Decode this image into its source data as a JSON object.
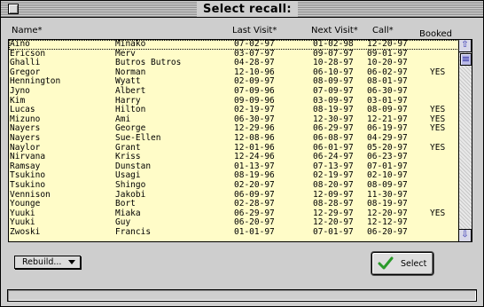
{
  "window": {
    "title": "Select recall:"
  },
  "columns": {
    "name": "Name*",
    "last_visit": "Last Visit*",
    "next_visit": "Next Visit*",
    "call": "Call*",
    "booked": "Booked"
  },
  "rows": [
    {
      "last": "Aino",
      "first": "Minako",
      "last_visit": "07-02-97",
      "next_visit": "01-02-98",
      "call": "12-20-97",
      "booked": ""
    },
    {
      "last": "Ericson",
      "first": "Merv",
      "last_visit": "03-07-97",
      "next_visit": "09-07-97",
      "call": "09-01-97",
      "booked": ""
    },
    {
      "last": "Ghalli",
      "first": "Butros Butros",
      "last_visit": "04-28-97",
      "next_visit": "10-28-97",
      "call": "10-20-97",
      "booked": ""
    },
    {
      "last": "Gregor",
      "first": "Norman",
      "last_visit": "12-10-96",
      "next_visit": "06-10-97",
      "call": "06-02-97",
      "booked": "YES"
    },
    {
      "last": "Hennington",
      "first": "Wyatt",
      "last_visit": "02-09-97",
      "next_visit": "08-09-97",
      "call": "08-01-97",
      "booked": ""
    },
    {
      "last": "Jyno",
      "first": "Albert",
      "last_visit": "07-09-96",
      "next_visit": "07-09-97",
      "call": "06-30-97",
      "booked": ""
    },
    {
      "last": "Kim",
      "first": "Harry",
      "last_visit": "09-09-96",
      "next_visit": "03-09-97",
      "call": "03-01-97",
      "booked": ""
    },
    {
      "last": "Lucas",
      "first": "Hilton",
      "last_visit": "02-19-97",
      "next_visit": "08-19-97",
      "call": "08-09-97",
      "booked": "YES"
    },
    {
      "last": "Mizuno",
      "first": "Ami",
      "last_visit": "06-30-97",
      "next_visit": "12-30-97",
      "call": "12-21-97",
      "booked": "YES"
    },
    {
      "last": "Nayers",
      "first": "George",
      "last_visit": "12-29-96",
      "next_visit": "06-29-97",
      "call": "06-19-97",
      "booked": "YES"
    },
    {
      "last": "Nayers",
      "first": "Sue-Ellen",
      "last_visit": "12-08-96",
      "next_visit": "06-08-97",
      "call": "04-29-97",
      "booked": ""
    },
    {
      "last": "Naylor",
      "first": "Grant",
      "last_visit": "12-01-96",
      "next_visit": "06-01-97",
      "call": "05-20-97",
      "booked": "YES"
    },
    {
      "last": "Nirvana",
      "first": "Kriss",
      "last_visit": "12-24-96",
      "next_visit": "06-24-97",
      "call": "06-23-97",
      "booked": ""
    },
    {
      "last": "Ramsay",
      "first": "Dunstan",
      "last_visit": "01-13-97",
      "next_visit": "07-13-97",
      "call": "07-01-97",
      "booked": ""
    },
    {
      "last": "Tsukino",
      "first": "Usagi",
      "last_visit": "08-19-96",
      "next_visit": "02-19-97",
      "call": "02-10-97",
      "booked": ""
    },
    {
      "last": "Tsukino",
      "first": "Shingo",
      "last_visit": "02-20-97",
      "next_visit": "08-20-97",
      "call": "08-09-97",
      "booked": ""
    },
    {
      "last": "Vennison",
      "first": "Jakobi",
      "last_visit": "06-09-97",
      "next_visit": "12-09-97",
      "call": "11-30-97",
      "booked": ""
    },
    {
      "last": "Younge",
      "first": "Bort",
      "last_visit": "02-28-97",
      "next_visit": "08-28-97",
      "call": "08-19-97",
      "booked": ""
    },
    {
      "last": "Yuuki",
      "first": "Miaka",
      "last_visit": "06-29-97",
      "next_visit": "12-29-97",
      "call": "12-20-97",
      "booked": "YES"
    },
    {
      "last": "Yuuki",
      "first": "Guy",
      "last_visit": "06-20-97",
      "next_visit": "12-20-97",
      "call": "12-12-97",
      "booked": ""
    },
    {
      "last": "Zwoski",
      "first": "Francis",
      "last_visit": "01-01-97",
      "next_visit": "07-01-97",
      "call": "06-20-97",
      "booked": ""
    }
  ],
  "buttons": {
    "rebuild_label": "Rebuild...",
    "select_label": "Select"
  },
  "icons": {
    "close": "close-box-icon",
    "scroll_up": "scroll-up-arrow-icon",
    "scroll_down": "scroll-down-arrow-icon",
    "select": "green-checkmark-icon",
    "popup": "popup-triangle-icon"
  },
  "colors": {
    "list_background": "#fffcc8",
    "window_background": "#cecece",
    "scroll_accent": "#2b2bb0",
    "check_green": "#2a9a2a"
  },
  "status": {
    "text": ""
  }
}
